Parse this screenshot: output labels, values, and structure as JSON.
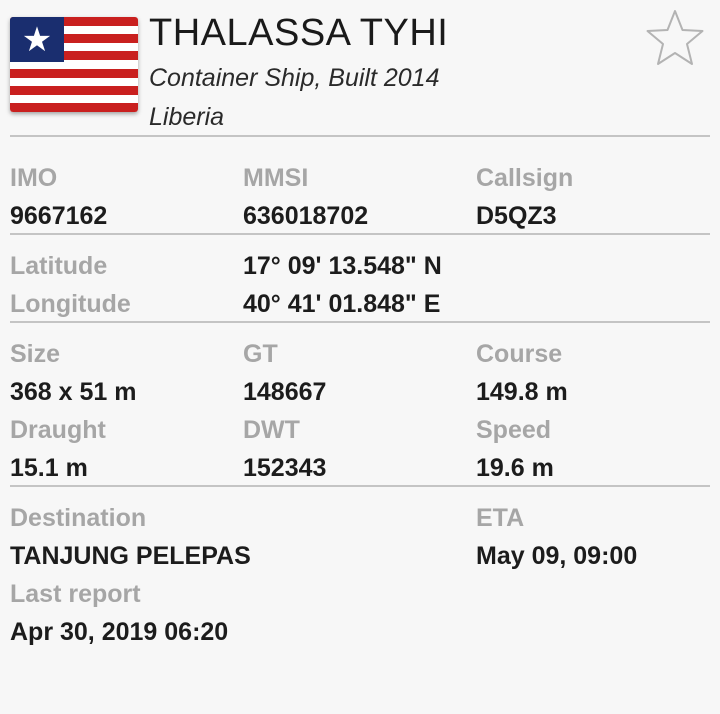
{
  "vessel": {
    "name": "THALASSA TYHI",
    "type_built": "Container Ship, Built 2014",
    "flag_country": "Liberia",
    "flag_icon": "liberia-flag-icon",
    "favorite_icon": "star-outline-icon"
  },
  "ids": {
    "imo_label": "IMO",
    "imo_value": "9667162",
    "mmsi_label": "MMSI",
    "mmsi_value": "636018702",
    "callsign_label": "Callsign",
    "callsign_value": "D5QZ3"
  },
  "position": {
    "latitude_label": "Latitude",
    "latitude_value": "17° 09' 13.548\" N",
    "longitude_label": "Longitude",
    "longitude_value": "40° 41' 01.848\" E"
  },
  "dimensions": {
    "size_label": "Size",
    "size_value": "368 x 51 m",
    "gt_label": "GT",
    "gt_value": "148667",
    "course_label": "Course",
    "course_value": "149.8 m",
    "draught_label": "Draught",
    "draught_value": "15.1 m",
    "dwt_label": "DWT",
    "dwt_value": "152343",
    "speed_label": "Speed",
    "speed_value": "19.6 m"
  },
  "voyage": {
    "destination_label": "Destination",
    "destination_value": "TANJUNG PELEPAS",
    "eta_label": "ETA",
    "eta_value": "May 09, 09:00",
    "last_report_label": "Last report",
    "last_report_value": "Apr 30, 2019 06:20"
  },
  "colors": {
    "label_gray": "#a6a6a6",
    "value_dark": "#1c1c1c",
    "divider": "#c4c4c4",
    "flag_red": "#c9201f",
    "flag_blue": "#1a2e6f"
  }
}
